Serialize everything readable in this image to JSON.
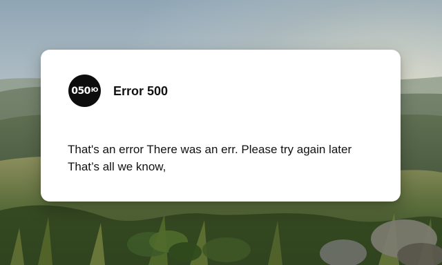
{
  "error_card": {
    "badge_text": "050",
    "badge_suffix": "Ю",
    "title": "Error 500",
    "messages": [
      "That's an error There was an err. Please try again later",
      "That’s all we know,"
    ]
  },
  "background": {
    "scene": "landscape-photo"
  }
}
